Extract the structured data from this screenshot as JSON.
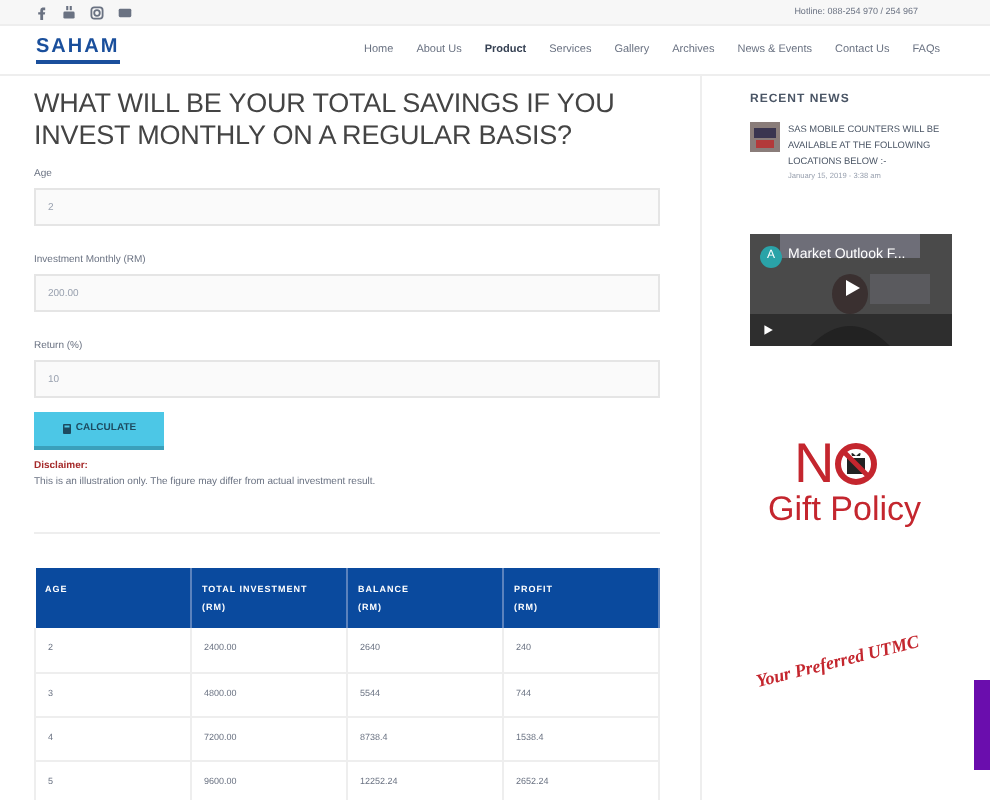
{
  "topbar": {
    "hotline": "Hotline: 088-254 970 / 254 967"
  },
  "logo": {
    "text": "SAHAM"
  },
  "nav": [
    {
      "label": "Home",
      "selected": false
    },
    {
      "label": "About Us",
      "selected": false
    },
    {
      "label": "Product",
      "selected": true
    },
    {
      "label": "Services",
      "selected": false
    },
    {
      "label": "Gallery",
      "selected": false
    },
    {
      "label": "Archives",
      "selected": false
    },
    {
      "label": "News & Events",
      "selected": false
    },
    {
      "label": "Contact Us",
      "selected": false
    },
    {
      "label": "FAQs",
      "selected": false
    }
  ],
  "heading": "WHAT WILL BE YOUR TOTAL SAVINGS IF YOU INVEST MONTHLY ON A REGULAR BASIS?",
  "fields": [
    {
      "label": "Age",
      "value": "2"
    },
    {
      "label": "Investment Monthly (RM)",
      "value": "200.00"
    },
    {
      "label": "Return (%)",
      "value": "10"
    }
  ],
  "calculate_button": "CALCULATE",
  "disclaimer": {
    "title": "Disclaimer:",
    "text": "This is an illustration only. The figure may differ from actual investment result."
  },
  "table": {
    "columns": [
      "AGE",
      "TOTAL INVESTMENT\n(RM)",
      "BALANCE\n(RM)",
      "PROFIT\n(RM)"
    ],
    "rows": [
      [
        "2",
        "2400.00",
        "2640",
        "240"
      ],
      [
        "3",
        "4800.00",
        "5544",
        "744"
      ],
      [
        "4",
        "7200.00",
        "8738.4",
        "1538.4"
      ],
      [
        "5",
        "9600.00",
        "12252.24",
        "2652.24"
      ]
    ]
  },
  "sidebar": {
    "title": "RECENT NEWS",
    "news": [
      {
        "title": "SAS MOBILE COUNTERS WILL BE AVAILABLE AT THE FOLLOWING LOCATIONS BELOW :-",
        "date": "January 15, 2019 - 3:38 am"
      }
    ],
    "video": {
      "avatar": "A",
      "title": "Market Outlook F..."
    },
    "no_gift": {
      "letter": "N",
      "text": "Gift Policy"
    },
    "slogan": "Your Preferred UTMC"
  }
}
